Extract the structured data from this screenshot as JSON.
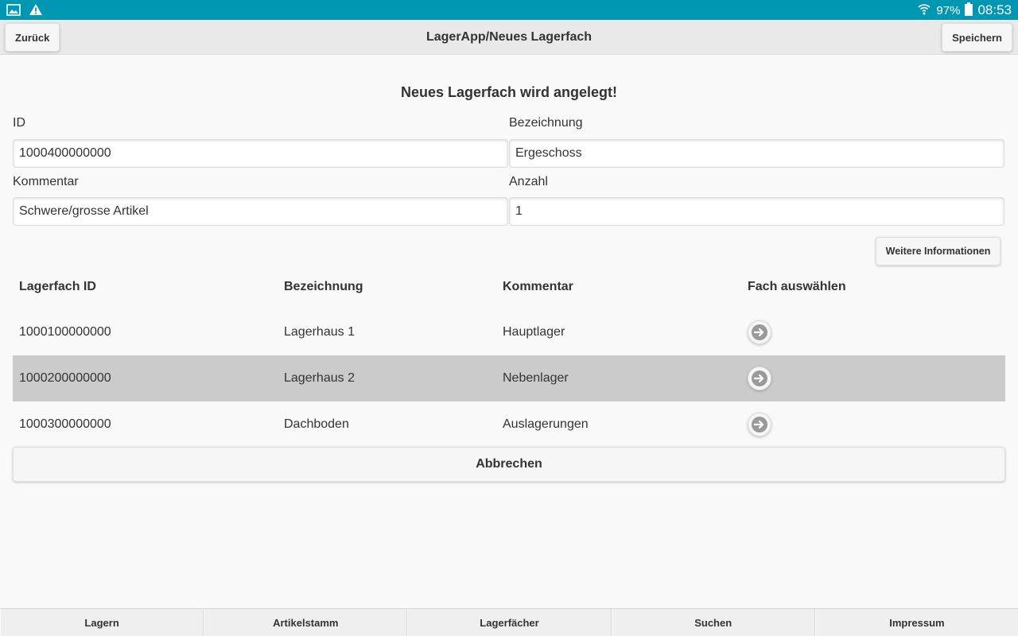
{
  "statusbar": {
    "battery": "97%",
    "time": "08:53"
  },
  "header": {
    "back_label": "Zurück",
    "title": "LagerApp/Neues Lagerfach",
    "save_label": "Speichern"
  },
  "form": {
    "heading": "Neues Lagerfach wird angelegt!",
    "id_label": "ID",
    "id_value": "1000400000000",
    "bezeichnung_label": "Bezeichnung",
    "bezeichnung_value": "Ergeschoss",
    "kommentar_label": "Kommentar",
    "kommentar_value": "Schwere/grosse Artikel",
    "anzahl_label": "Anzahl",
    "anzahl_value": "1",
    "more_info_label": "Weitere Informationen"
  },
  "table": {
    "headers": [
      "Lagerfach ID",
      "Bezeichnung",
      "Kommentar",
      "Fach auswählen"
    ],
    "rows": [
      {
        "id": "1000100000000",
        "bezeichnung": "Lagerhaus 1",
        "kommentar": "Hauptlager"
      },
      {
        "id": "1000200000000",
        "bezeichnung": "Lagerhaus 2",
        "kommentar": "Nebenlager"
      },
      {
        "id": "1000300000000",
        "bezeichnung": "Dachboden",
        "kommentar": "Auslagerungen"
      }
    ]
  },
  "cancel_label": "Abbrechen",
  "footer": {
    "items": [
      "Lagern",
      "Artikelstamm",
      "Lagerfächer",
      "Suchen",
      "Impressum"
    ]
  }
}
